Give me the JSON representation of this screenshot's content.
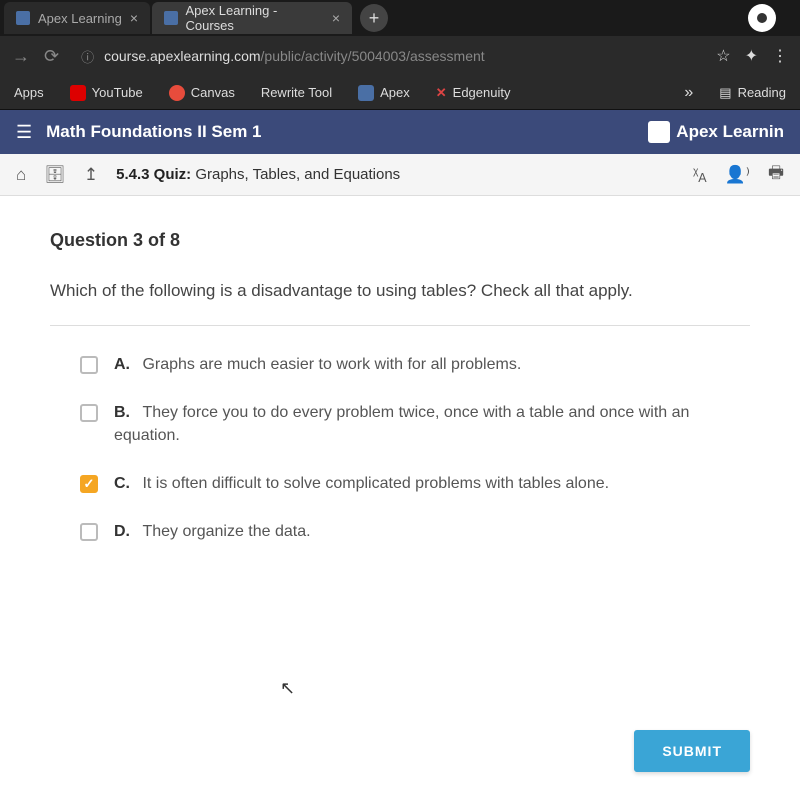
{
  "browser": {
    "tabs": [
      {
        "title": "Apex Learning",
        "active": false
      },
      {
        "title": "Apex Learning - Courses",
        "active": true
      }
    ],
    "url_main": "course.apexlearning.com",
    "url_path": "/public/activity/5004003/assessment",
    "bookmarks": {
      "apps": "Apps",
      "youtube": "YouTube",
      "canvas": "Canvas",
      "rewrite": "Rewrite Tool",
      "apex": "Apex",
      "edgenuity": "Edgenuity",
      "more": "»",
      "reading": "Reading"
    }
  },
  "header": {
    "course": "Math Foundations II Sem 1",
    "brand": "Apex Learnin"
  },
  "breadcrumb": {
    "number": "5.4.3 Quiz:",
    "title": "Graphs, Tables, and Equations"
  },
  "quiz": {
    "header": "Question 3 of 8",
    "prompt": "Which of the following is a disadvantage to using tables? Check all that apply.",
    "options": {
      "a": {
        "letter": "A.",
        "text": "Graphs are much easier to work with for all problems.",
        "checked": false
      },
      "b": {
        "letter": "B.",
        "text": "They force you to do every problem twice, once with a table and once with an equation.",
        "checked": false
      },
      "c": {
        "letter": "C.",
        "text": "It is often difficult to solve complicated problems with tables alone.",
        "checked": true
      },
      "d": {
        "letter": "D.",
        "text": "They organize the data.",
        "checked": false
      }
    },
    "submit": "SUBMIT"
  }
}
